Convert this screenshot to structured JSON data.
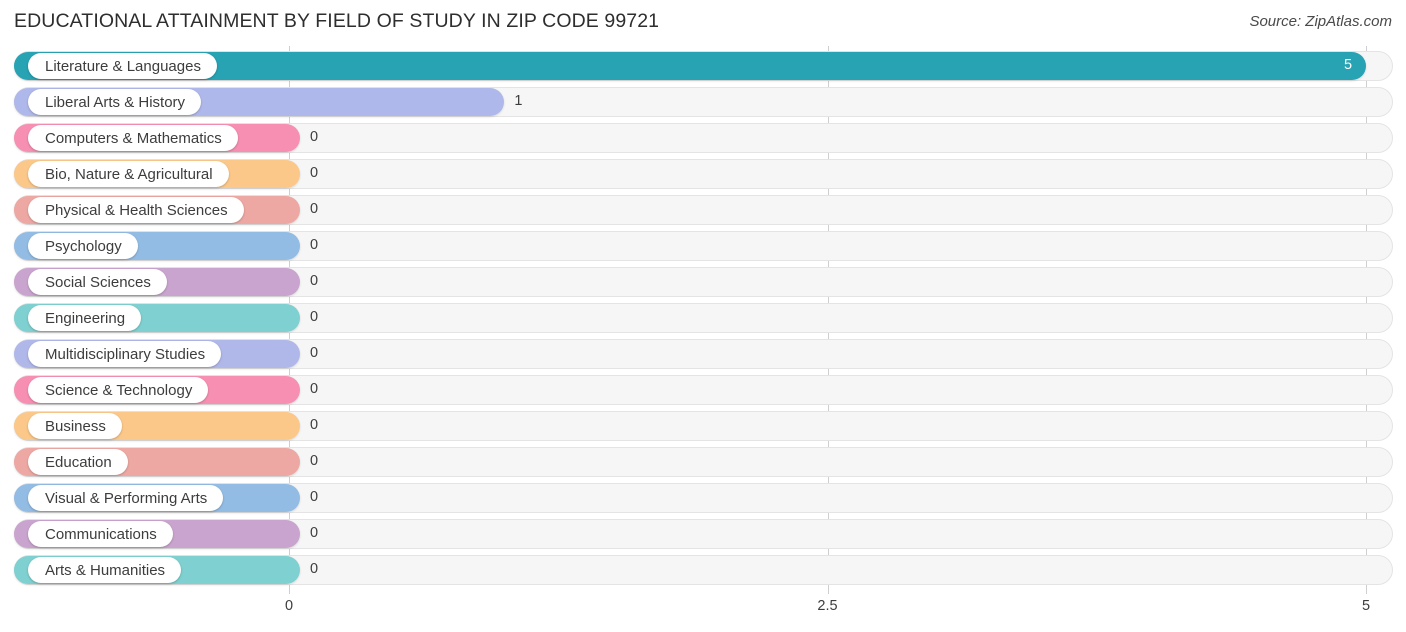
{
  "header": {
    "title": "EDUCATIONAL ATTAINMENT BY FIELD OF STUDY IN ZIP CODE 99721",
    "source": "Source: ZipAtlas.com"
  },
  "chart_data": {
    "type": "bar",
    "orientation": "horizontal",
    "title": "EDUCATIONAL ATTAINMENT BY FIELD OF STUDY IN ZIP CODE 99721",
    "xlabel": "",
    "ylabel": "",
    "xlim": [
      0,
      5
    ],
    "grid": true,
    "legend": "none",
    "xticks": [
      "0",
      "2.5",
      "5"
    ],
    "xtick_values": [
      0,
      2.5,
      5
    ],
    "categories": [
      "Literature & Languages",
      "Liberal Arts & History",
      "Computers & Mathematics",
      "Bio, Nature & Agricultural",
      "Physical & Health Sciences",
      "Psychology",
      "Social Sciences",
      "Engineering",
      "Multidisciplinary Studies",
      "Science & Technology",
      "Business",
      "Education",
      "Visual & Performing Arts",
      "Communications",
      "Arts & Humanities"
    ],
    "values": [
      5,
      1,
      0,
      0,
      0,
      0,
      0,
      0,
      0,
      0,
      0,
      0,
      0,
      0,
      0
    ],
    "value_labels": [
      "5",
      "1",
      "0",
      "0",
      "0",
      "0",
      "0",
      "0",
      "0",
      "0",
      "0",
      "0",
      "0",
      "0",
      "0"
    ],
    "colors": [
      "#27a3b4",
      "#afb8ea",
      "#f78fb3",
      "#fbc889",
      "#eda8a3",
      "#93bce4",
      "#c9a4ce",
      "#7fd0d0",
      "#b0b8ea",
      "#f78fb3",
      "#fbc889",
      "#eda8a3",
      "#93bce4",
      "#c9a4ce",
      "#7fd0d0"
    ]
  }
}
